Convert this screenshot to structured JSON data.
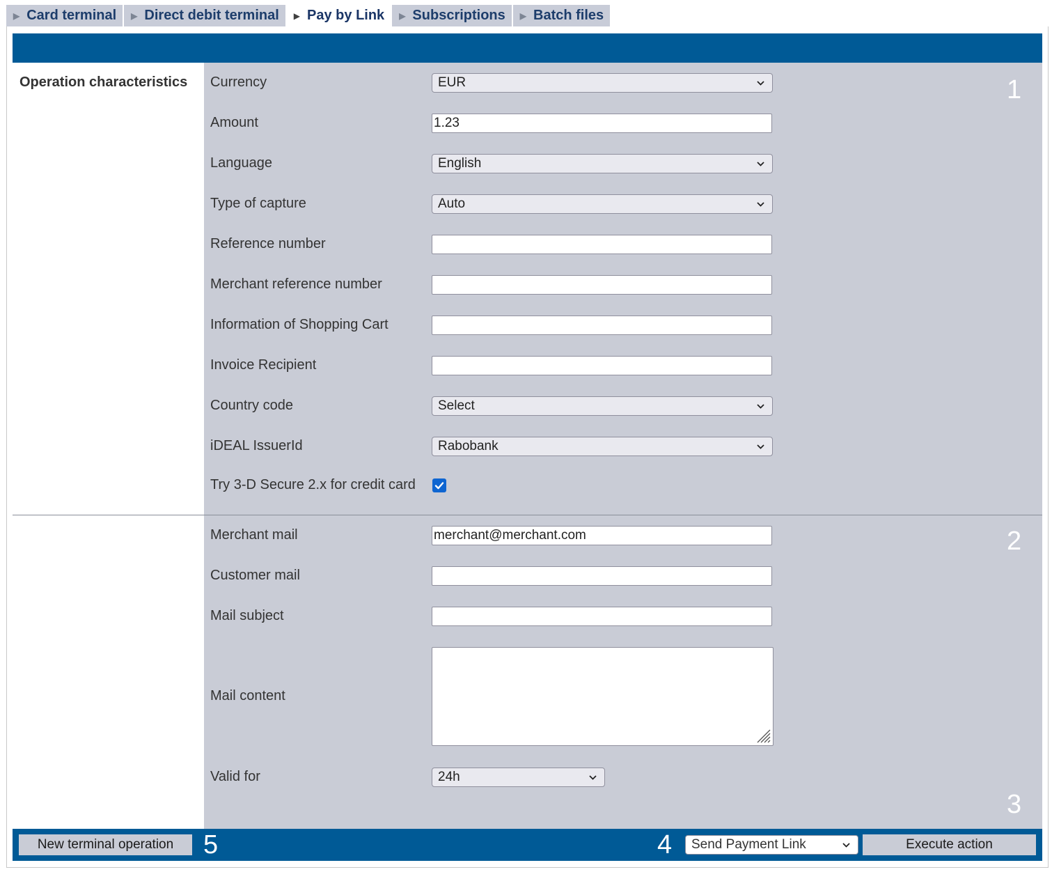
{
  "tabs": [
    {
      "label": "Card terminal"
    },
    {
      "label": "Direct debit terminal"
    },
    {
      "label": "Pay by Link"
    },
    {
      "label": "Subscriptions"
    },
    {
      "label": "Batch files"
    }
  ],
  "active_tab": "Pay by Link",
  "section_title": "Operation characteristics",
  "step_numbers": {
    "one": "1",
    "two": "2",
    "three": "3",
    "four": "4",
    "five": "5"
  },
  "fields": {
    "currency": {
      "label": "Currency",
      "value": "EUR"
    },
    "amount": {
      "label": "Amount",
      "value": "1.23"
    },
    "language": {
      "label": "Language",
      "value": "English"
    },
    "capture": {
      "label": "Type of capture",
      "value": "Auto"
    },
    "reference": {
      "label": "Reference number",
      "value": ""
    },
    "merchant_reference": {
      "label": "Merchant reference number",
      "value": ""
    },
    "shopping_cart": {
      "label": "Information of Shopping Cart",
      "value": ""
    },
    "invoice_recipient": {
      "label": "Invoice Recipient",
      "value": ""
    },
    "country_code": {
      "label": "Country code",
      "value": "Select"
    },
    "ideal_issuer": {
      "label": "iDEAL IssuerId",
      "value": "Rabobank"
    },
    "secure3d": {
      "label": "Try 3-D Secure 2.x for credit card",
      "checked": true
    },
    "merchant_mail": {
      "label": "Merchant mail",
      "value": "merchant@merchant.com"
    },
    "customer_mail": {
      "label": "Customer mail",
      "value": ""
    },
    "mail_subject": {
      "label": "Mail subject",
      "value": ""
    },
    "mail_content": {
      "label": "Mail content",
      "value": ""
    },
    "valid_for": {
      "label": "Valid for",
      "value": "24h"
    }
  },
  "footer": {
    "new_operation_label": "New terminal operation",
    "action_select_value": "Send Payment Link",
    "execute_label": "Execute action"
  },
  "colors": {
    "brand_blue": "#005a96",
    "panel_gray": "#c9ccd6",
    "checkbox_blue": "#0e65d1"
  }
}
